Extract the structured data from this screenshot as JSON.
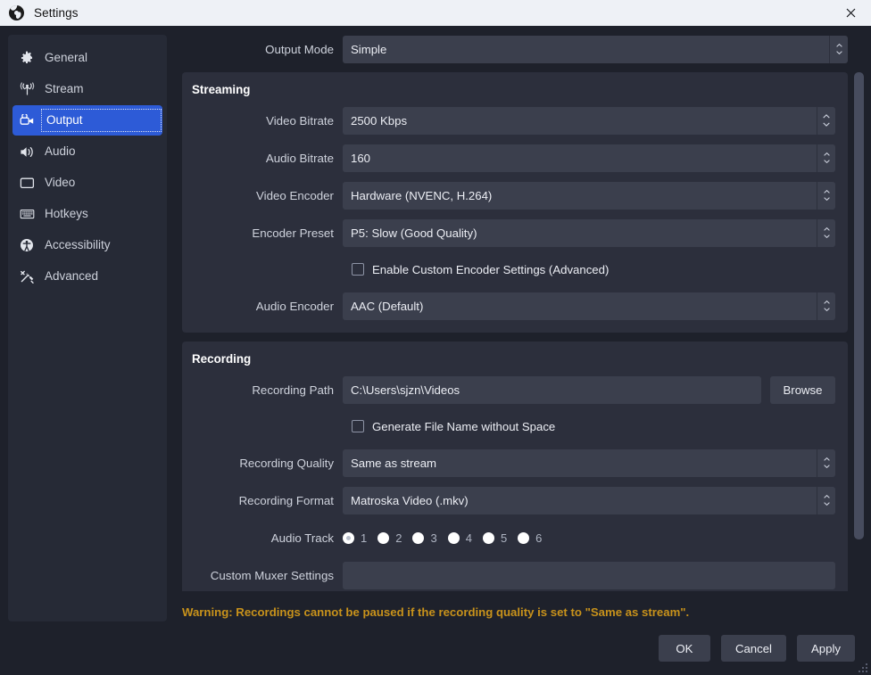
{
  "window": {
    "title": "Settings",
    "logo_icon": "obs-logo-icon",
    "close_icon": "close-icon"
  },
  "sidebar": {
    "items": [
      {
        "label": "General",
        "icon": "gear-icon",
        "selected": false
      },
      {
        "label": "Stream",
        "icon": "broadcast-icon",
        "selected": false
      },
      {
        "label": "Output",
        "icon": "output-camera-icon",
        "selected": true
      },
      {
        "label": "Audio",
        "icon": "speaker-icon",
        "selected": false
      },
      {
        "label": "Video",
        "icon": "monitor-icon",
        "selected": false
      },
      {
        "label": "Hotkeys",
        "icon": "keyboard-icon",
        "selected": false
      },
      {
        "label": "Accessibility",
        "icon": "accessibility-icon",
        "selected": false
      },
      {
        "label": "Advanced",
        "icon": "tools-icon",
        "selected": false
      }
    ]
  },
  "output_mode": {
    "label": "Output Mode",
    "value": "Simple"
  },
  "streaming": {
    "title": "Streaming",
    "video_bitrate": {
      "label": "Video Bitrate",
      "value": "2500 Kbps"
    },
    "audio_bitrate": {
      "label": "Audio Bitrate",
      "value": "160"
    },
    "video_encoder": {
      "label": "Video Encoder",
      "value": "Hardware (NVENC, H.264)"
    },
    "encoder_preset": {
      "label": "Encoder Preset",
      "value": "P5: Slow (Good Quality)"
    },
    "custom_encoder": {
      "label": "Enable Custom Encoder Settings (Advanced)",
      "checked": false
    },
    "audio_encoder": {
      "label": "Audio Encoder",
      "value": "AAC (Default)"
    }
  },
  "recording": {
    "title": "Recording",
    "recording_path": {
      "label": "Recording Path",
      "value": "C:\\Users\\sjzn\\Videos"
    },
    "browse_label": "Browse",
    "generate_no_space": {
      "label": "Generate File Name without Space",
      "checked": false
    },
    "recording_quality": {
      "label": "Recording Quality",
      "value": "Same as stream"
    },
    "recording_format": {
      "label": "Recording Format",
      "value": "Matroska Video (.mkv)"
    },
    "audio_track": {
      "label": "Audio Track",
      "tracks": [
        "1",
        "2",
        "3",
        "4",
        "5",
        "6"
      ],
      "selected": "1"
    },
    "custom_muxer": {
      "label": "Custom Muxer Settings",
      "value": ""
    }
  },
  "warning": {
    "text": "Warning: Recordings cannot be paused if the recording quality is set to \"Same as stream\".",
    "color": "#c8921b"
  },
  "footer": {
    "ok_label": "OK",
    "cancel_label": "Cancel",
    "apply_label": "Apply"
  },
  "colors": {
    "accent": "#2d5bd7",
    "window_bg": "#1e212b",
    "group_bg": "#2c2f3c",
    "input_bg": "#3b3f4d",
    "titlebar_bg": "#eef1f6"
  }
}
